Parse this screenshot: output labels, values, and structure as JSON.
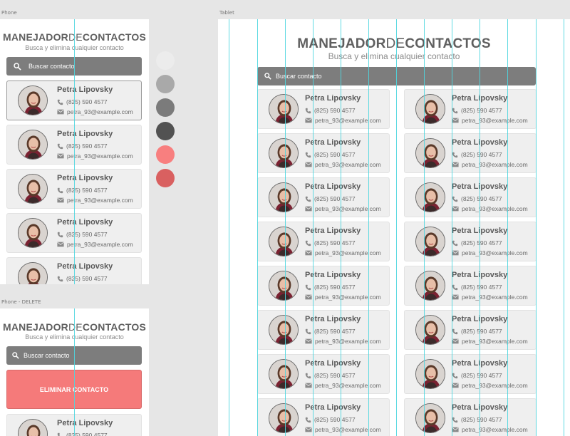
{
  "artboards": {
    "phone_label": "Phone",
    "phone_delete_label": "Phone - DELETE",
    "tablet_label": "Tablet"
  },
  "app": {
    "title_part1": "MANEJADOR",
    "title_part2": "DE",
    "title_part3": "CONTACTOS",
    "subtitle": "Busca y elimina cualquier contacto",
    "search_placeholder": "Buscar contacto",
    "delete_button": "ELIMINAR CONTACTO"
  },
  "contact": {
    "name": "Petra Lipovsky",
    "phone": "(825) 590 4577",
    "email": "petra_93@example.com"
  },
  "swatches": [
    "#ececec",
    "#a9a9a9",
    "#7b7b7b",
    "#525252",
    "#f87f7f",
    "#d96060"
  ],
  "colors": {
    "guide": "#4fd6df",
    "accent_red": "#f57a7a",
    "search_bg": "#7d7d7d"
  }
}
